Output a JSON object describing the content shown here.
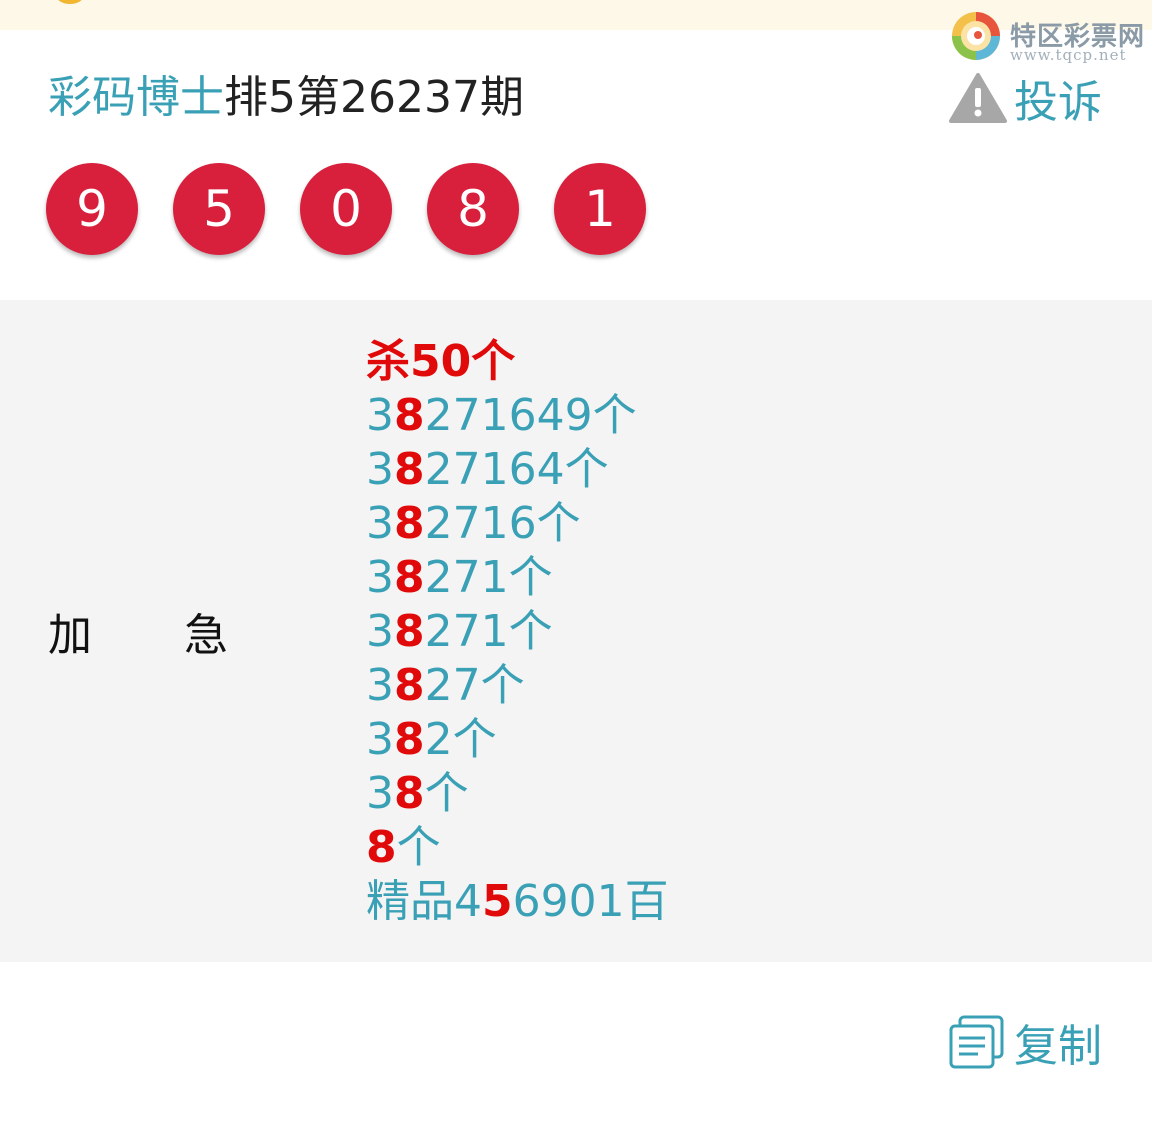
{
  "brand": {
    "name": "特区彩票网",
    "url": "www.tqcp.net"
  },
  "header": {
    "source": "彩码博士",
    "issue": "排5第26237期",
    "complain_label": "投诉"
  },
  "draw": {
    "numbers": [
      "9",
      "5",
      "0",
      "8",
      "1"
    ]
  },
  "prediction": {
    "label_chars": [
      "加",
      "急"
    ],
    "kill_line": "杀50个",
    "lines": [
      {
        "pre": "3",
        "hl": "8",
        "post": "271649个"
      },
      {
        "pre": "3",
        "hl": "8",
        "post": "27164个"
      },
      {
        "pre": "3",
        "hl": "8",
        "post": "2716个"
      },
      {
        "pre": "3",
        "hl": "8",
        "post": "271个"
      },
      {
        "pre": "3",
        "hl": "8",
        "post": "271个"
      },
      {
        "pre": "3",
        "hl": "8",
        "post": "27个"
      },
      {
        "pre": "3",
        "hl": "8",
        "post": "2个"
      },
      {
        "pre": "3",
        "hl": "8",
        "post": "个"
      },
      {
        "pre": "",
        "hl": "8",
        "post": "个"
      },
      {
        "pre": "精品4",
        "hl": "5",
        "post": "6901百"
      }
    ]
  },
  "footer": {
    "copy_label": "复制"
  },
  "colors": {
    "accent": "#3aa0b6",
    "ball": "#d81f3c",
    "highlight": "#e10a0a",
    "panel_bg": "#f4f4f4",
    "top_bar": "#fdf8e8"
  }
}
